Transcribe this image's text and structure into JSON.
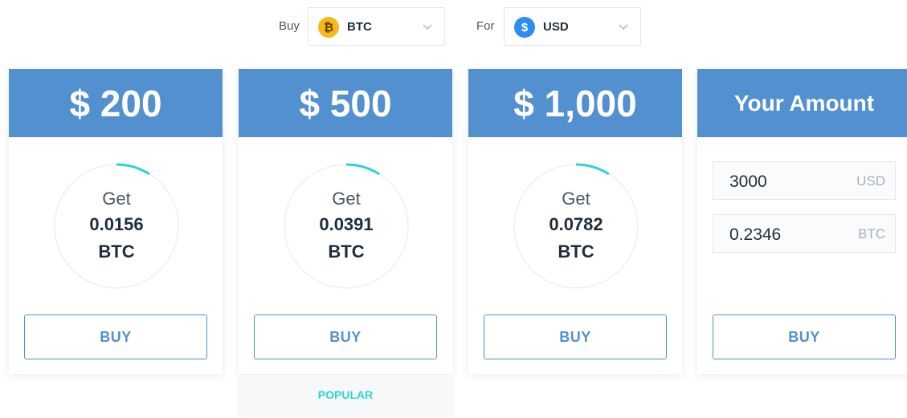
{
  "selectors": {
    "buy_label": "Buy",
    "buy_coin": {
      "symbol": "₿",
      "value": "BTC",
      "icon": "bitcoin-icon",
      "color": "#f7b918"
    },
    "for_label": "For",
    "for_coin": {
      "symbol": "$",
      "value": "USD",
      "icon": "dollar-icon",
      "color": "#2d8cf0"
    }
  },
  "cards": [
    {
      "price": "$ 200",
      "get_label": "Get",
      "amount": "0.0156",
      "unit": "BTC",
      "buy_label": "BUY"
    },
    {
      "price": "$ 500",
      "get_label": "Get",
      "amount": "0.0391",
      "unit": "BTC",
      "buy_label": "BUY",
      "badge": "POPULAR"
    },
    {
      "price": "$ 1,000",
      "get_label": "Get",
      "amount": "0.0782",
      "unit": "BTC",
      "buy_label": "BUY"
    }
  ],
  "custom": {
    "title": "Your Amount",
    "fiat_value": "3000",
    "fiat_unit": "USD",
    "crypto_value": "0.2346",
    "crypto_unit": "BTC",
    "buy_label": "BUY"
  },
  "colors": {
    "header_blue": "#5290cf",
    "ring_accent": "#2dd4d4",
    "popular_text": "#2dd4d4"
  }
}
